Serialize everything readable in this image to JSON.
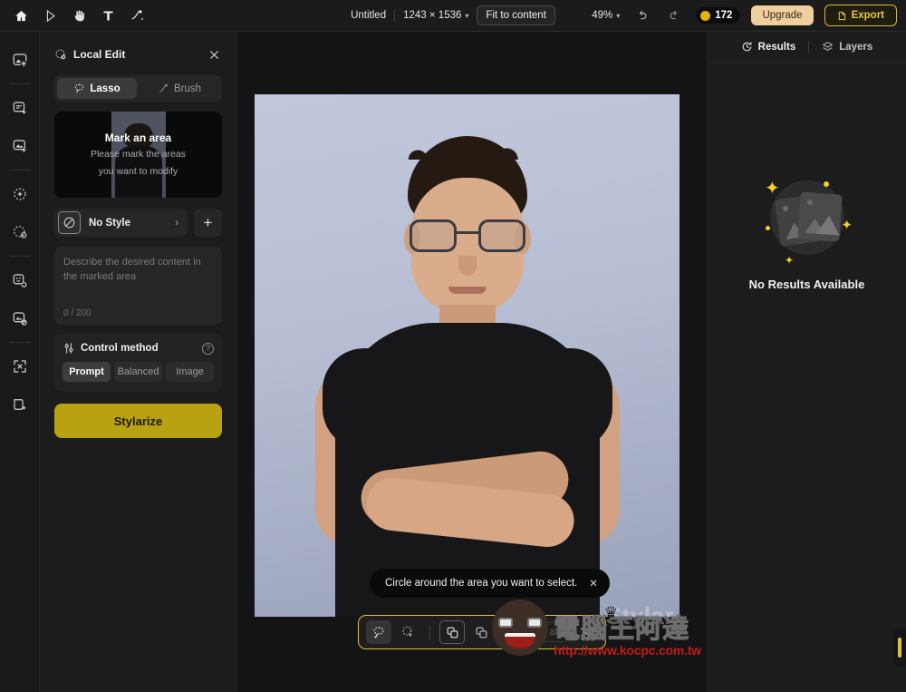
{
  "topbar": {
    "tools": [
      {
        "name": "home-icon",
        "label": "Home"
      },
      {
        "name": "cursor-icon",
        "label": "Select"
      },
      {
        "name": "hand-icon",
        "label": "Pan"
      },
      {
        "name": "text-icon",
        "label": "Text"
      },
      {
        "name": "brush-icon",
        "label": "Brush"
      }
    ],
    "doc_title": "Untitled",
    "dimensions": "1243 × 1536",
    "fit_label": "Fit to content",
    "zoom_level": "49%",
    "undo_label": "Undo",
    "redo_label": "Redo",
    "credits": "172",
    "upgrade_label": "Upgrade",
    "export_label": "Export"
  },
  "rail": {
    "items": [
      {
        "name": "image-upload-icon",
        "label": "Upload image"
      },
      {
        "name": "text-to-image-icon",
        "label": "Text to image"
      },
      {
        "name": "image-to-image-icon",
        "label": "Image to image"
      },
      {
        "name": "magic-select-icon",
        "label": "Magic select"
      },
      {
        "name": "local-edit-icon",
        "label": "Local edit"
      },
      {
        "name": "face-swap-icon",
        "label": "Face swap"
      },
      {
        "name": "retouch-icon",
        "label": "Retouch"
      },
      {
        "name": "upscale-icon",
        "label": "Upscale"
      },
      {
        "name": "expand-icon",
        "label": "Expand"
      }
    ]
  },
  "left_panel": {
    "title": "Local Edit",
    "close_label": "Close",
    "modes": [
      {
        "label": "Lasso",
        "icon": "lasso-icon",
        "active": true
      },
      {
        "label": "Brush",
        "icon": "brush-stroke-icon",
        "active": false
      }
    ],
    "mark_card": {
      "title": "Mark an area",
      "subtitle_line1": "Please mark the areas",
      "subtitle_line2": "you want to modify"
    },
    "style": {
      "name": "No Style",
      "icon": "no-style-icon",
      "arrow": "›",
      "add_label": "+"
    },
    "prompt": {
      "placeholder": "Describe the desired content in the marked area",
      "value": "",
      "counter": "0 / 200"
    },
    "control_method": {
      "title": "Control method",
      "help": "?",
      "options": [
        {
          "label": "Prompt",
          "active": true
        },
        {
          "label": "Balanced",
          "active": false
        },
        {
          "label": "Image",
          "active": false
        }
      ]
    },
    "primary_action": "Stylarize"
  },
  "canvas": {
    "brand_overlay": "Stylar",
    "tooltip": {
      "text": "Circle around the area you want to select.",
      "close": "✕"
    },
    "lasso_toolbar": {
      "buttons": [
        {
          "name": "freehand-lasso-icon",
          "label": "Freehand lasso",
          "active": true
        },
        {
          "name": "polygon-lasso-icon",
          "label": "Polygonal lasso",
          "active": false
        },
        {
          "name": "add-selection-icon",
          "label": "Add to selection",
          "active": false,
          "boxed": true
        },
        {
          "name": "subtract-selection-icon",
          "label": "Subtract from selection",
          "active": false,
          "boxed": false
        }
      ],
      "clear_label": "Clear all",
      "close_label": "✕"
    },
    "watermark": {
      "cn": "電腦王阿達",
      "url": "http://www.kocpc.com.tw"
    }
  },
  "right_panel": {
    "tabs": [
      {
        "label": "Results",
        "icon": "history-icon",
        "active": true
      },
      {
        "label": "Layers",
        "icon": "layers-icon",
        "active": false
      }
    ],
    "empty_state": {
      "label": "No Results Available",
      "icon": "empty-gallery-icon"
    }
  },
  "colors": {
    "accent_yellow": "#e0c33c",
    "primary_button": "#b9a212",
    "upgrade": "#efcfa0",
    "panel_bg": "#1c1c1c",
    "canvas_bg": "#141414"
  }
}
